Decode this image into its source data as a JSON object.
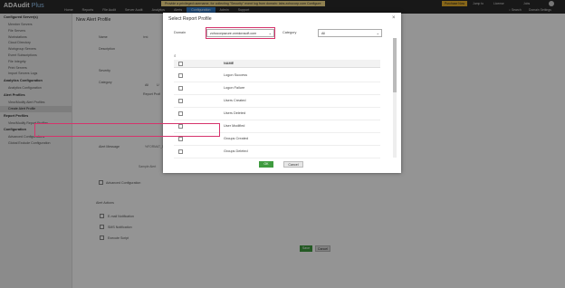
{
  "app": {
    "name": "ADAudit",
    "plus": "Plus"
  },
  "banner": "Provide a privileged username, for collecting \"Security\" event log from domain: labs.zohocorp.com Configure",
  "top_links": {
    "purchase": "Purchase Now",
    "jump_to": "Jump to",
    "license": "License",
    "jobs": "Jobs",
    "search": "Search",
    "domain_settings": "Domain Settings"
  },
  "nav": {
    "tabs": [
      "Home",
      "Reports",
      "File Audit",
      "Server Audit",
      "Analytics",
      "Alerts",
      "Configuration",
      "Admin",
      "Support"
    ],
    "active": "Configuration"
  },
  "sidebar": {
    "sections": [
      {
        "title": "Configured Server(s)",
        "items": [
          "Member Servers",
          "File Servers",
          "Workstations",
          "Cloud Directory",
          "Workgroup Servers",
          "Event Subscriptions",
          "File Integrity",
          "Print Servers",
          "Import Servers Logs"
        ]
      },
      {
        "title": "Analytics Configuration",
        "items": [
          "Analytics Configuration"
        ]
      },
      {
        "title": "Alert Profiles",
        "items": [
          "View/Modify Alert Profiles",
          "Create Alert Profile"
        ]
      },
      {
        "title": "Report Profiles",
        "items": [
          "View/Modify Report Profiles"
        ]
      },
      {
        "title": "Configuration",
        "items": [
          "Advanced Configurations",
          "Global Exclude Configuration"
        ]
      }
    ],
    "active_item": "Create Alert Profile"
  },
  "main": {
    "title": "New Alert Profile",
    "name_label": "Name",
    "name_value": "test",
    "description_label": "Description",
    "severity_label": "Severity",
    "category_label": "Category",
    "category_tab_all": "All",
    "category_tab_user": "U",
    "report_profiles_label": "Report Profi",
    "alert_message_label": "Alert Message",
    "alert_message_value": "%FORMAT_D",
    "sample_label": "Sample Alert",
    "advanced_config_label": "Advanced Configuration",
    "alert_actions_label": "Alert Actions",
    "email_notification": "E-mail Notification",
    "sms_notification": "SMS Notification",
    "execute_script": "Execute Script",
    "save_label": "Save",
    "cancel_label": "Cancel"
  },
  "dialog": {
    "title": "Select Report Profile",
    "close": "×",
    "domain_label": "Domain",
    "domain_value": "zohocorpazure.onmicrosoft.com",
    "category_label": "Category",
    "category_value": "All",
    "column_name": "NAME",
    "rows": [
      "Logon Success",
      "Logon Failure",
      "Users Created",
      "Users Deleted",
      "User Modified",
      "Groups Created",
      "Groups Deleted"
    ],
    "highlighted_row": "User Modified",
    "ok_label": "OK",
    "cancel_label": "Cancel"
  },
  "colors": {
    "topbar": "#2a2a2a",
    "accent_blue": "#2f7ccc",
    "highlight": "#d6336c",
    "ok_green": "#3f9b3f",
    "banner_yellow": "#f6dd8a"
  }
}
